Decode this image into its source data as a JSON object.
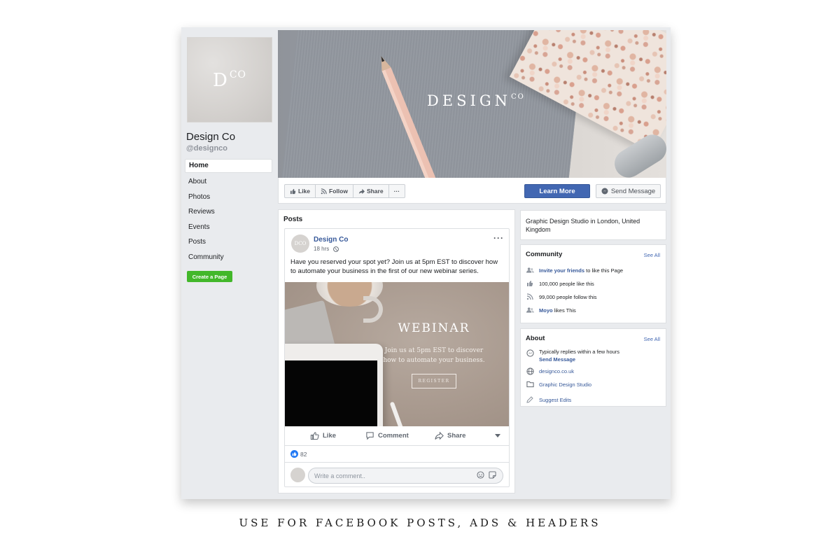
{
  "page": {
    "profile_logo": "D",
    "profile_logo_sup": "CO",
    "name": "Design Co",
    "handle": "@designco",
    "nav": [
      "Home",
      "About",
      "Photos",
      "Reviews",
      "Events",
      "Posts",
      "Community"
    ],
    "create_page_label": "Create a Page"
  },
  "cover": {
    "title": "DESIGN",
    "title_sup": "CO"
  },
  "action_bar": {
    "like_label": "Like",
    "follow_label": "Follow",
    "share_label": "Share",
    "more_label": "···",
    "learn_more_label": "Learn More",
    "send_message_label": "Send Message"
  },
  "posts": {
    "heading": "Posts",
    "author": "Design Co",
    "time": "18 hrs",
    "menu": "···",
    "avatar_text": "DCO",
    "text": "Have you reserved your spot yet? Join us at 5pm EST to discover how to automate your business in the first of our new webinar series.",
    "image": {
      "title": "WEBINAR",
      "subtitle_line1": "Join us at 5pm EST to discover",
      "subtitle_line2": "how to automate your business.",
      "register": "REGISTER"
    },
    "actions": {
      "like": "Like",
      "comment": "Comment",
      "share": "Share"
    },
    "reaction_count": "82",
    "comment_placeholder": "Write a comment.."
  },
  "sidebar": {
    "description": "Graphic Design Studio in London, United Kingdom",
    "community": {
      "title": "Community",
      "see_all": "See All",
      "invite_link": "Invite your friends",
      "invite_rest": "to like this Page",
      "likes": "100,000 people like this",
      "follows": "99,000 people follow this",
      "friend_name": "Moyo",
      "friend_rest": "likes This"
    },
    "about": {
      "title": "About",
      "see_all": "See All",
      "replies": "Typically replies within a few hours",
      "send_message": "Send Message",
      "website": "designco.co.uk",
      "category": "Graphic Design Studio",
      "suggest": "Suggest Edits"
    }
  },
  "caption": "USE FOR FACEBOOK POSTS, ADS & HEADERS",
  "colors": {
    "facebook_blue": "#4267b2",
    "link_blue": "#365899",
    "create_green": "#42b72a",
    "background_gray": "#e9ebee"
  }
}
